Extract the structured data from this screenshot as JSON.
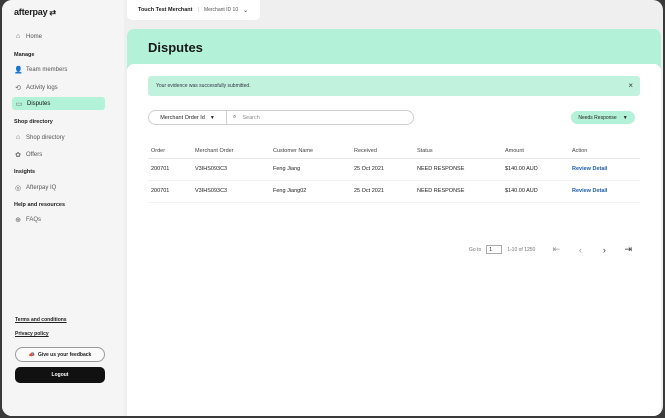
{
  "brand": {
    "name": "afterpay",
    "mark": "⇄"
  },
  "merchant": {
    "name": "Touch Test Merchant",
    "separator": "|",
    "id_label": "Merchant ID 10"
  },
  "sidebar": {
    "home": "Home",
    "manage_section": "Manage",
    "team_members": "Team members",
    "activity_logs": "Activity logs",
    "disputes": "Disputes",
    "shop_section": "Shop directory",
    "shop_directory": "Shop directory",
    "offers": "Offers",
    "insights_section": "Insights",
    "afterpay_iq": "Afterpay IQ",
    "help_section": "Help and resources",
    "faqs": "FAQs",
    "terms": "Terms and conditions",
    "privacy": "Privacy policy",
    "feedback": "Give us your feedback",
    "logout": "Logout"
  },
  "page": {
    "title": "Disputes"
  },
  "alert": {
    "message": "Your evidence was successfully submitted.",
    "close": "×"
  },
  "filters": {
    "field_select": "Merchant Order Id",
    "search_placeholder": "Search",
    "status_select": "Needs Response"
  },
  "table": {
    "headers": {
      "order": "Order",
      "merchant_order": "Merchant Order",
      "customer": "Customer Name",
      "received": "Received",
      "status": "Status",
      "amount": "Amount",
      "action": "Action"
    },
    "rows": [
      {
        "order": "200701",
        "merchant_order": "V3IHS093C3",
        "customer": "Feng Jiang",
        "received": "25 Oct 2021",
        "status": "NEED RESPONSE",
        "amount": "$140.00 AUD",
        "action": "Review Detail"
      },
      {
        "order": "200701",
        "merchant_order": "V3IHS093C3",
        "customer": "Feng Jiang02",
        "received": "25 Oct 2021",
        "status": "NEED RESPONSE",
        "amount": "$140.00 AUD",
        "action": "Review Detail"
      }
    ]
  },
  "pagination": {
    "goto_label": "Go to",
    "page_value": "1",
    "range": "1-10 of 1250"
  },
  "colors": {
    "accent": "#b3f1d9",
    "link": "#1f5ea8",
    "dark": "#111111"
  }
}
